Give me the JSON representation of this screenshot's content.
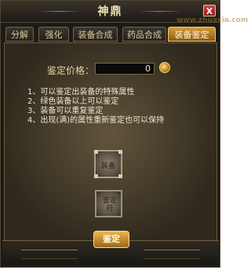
{
  "window": {
    "title": "神鼎",
    "close_label": "X",
    "watermark": "www.zhuaxia.com"
  },
  "tabs": [
    {
      "label": "分解",
      "active": false
    },
    {
      "label": "强化",
      "active": false
    },
    {
      "label": "装备合成",
      "active": false
    },
    {
      "label": "药品合成",
      "active": false
    },
    {
      "label": "装备鉴定",
      "active": true
    }
  ],
  "appraisal": {
    "price_label": "鉴定价格：",
    "price_value": "0",
    "rules": [
      "1、可以鉴定出装备的特殊属性",
      "2、绿色装备以上可以鉴定",
      "3、装备可以重复鉴定",
      "4、出现(满)的属性重新鉴定也可以保持"
    ],
    "equip_slot_label": "装备",
    "scroll_slot_label": "鉴定符",
    "button_label": "鉴定"
  }
}
